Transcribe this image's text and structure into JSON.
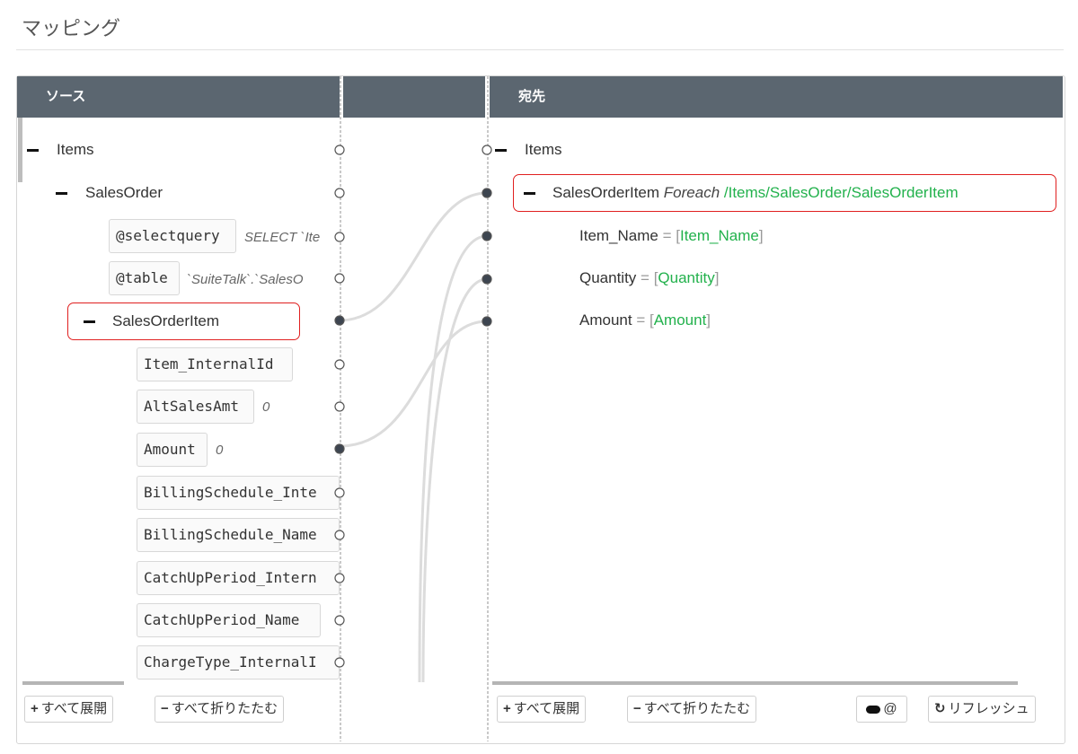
{
  "page": {
    "title": "マッピング"
  },
  "source": {
    "header": "ソース",
    "nodes": {
      "items": "Items",
      "sales_order": "SalesOrder",
      "select_query": {
        "name": "@selectquery",
        "value": "SELECT `Ite"
      },
      "table": {
        "name": "@table",
        "value": "`SuiteTalk`.`SalesO"
      },
      "sales_order_item": "SalesOrderItem",
      "fields": [
        {
          "name": "Item_InternalId",
          "value": ""
        },
        {
          "name": "AltSalesAmt",
          "value": "0"
        },
        {
          "name": "Amount",
          "value": "0"
        },
        {
          "name": "BillingSchedule_Inte",
          "value": ""
        },
        {
          "name": "BillingSchedule_Name",
          "value": ""
        },
        {
          "name": "CatchUpPeriod_Intern",
          "value": ""
        },
        {
          "name": "CatchUpPeriod_Name",
          "value": ""
        },
        {
          "name": "ChargeType_InternalI",
          "value": ""
        }
      ]
    },
    "buttons": {
      "expand_all": "すべて展開",
      "collapse_all": "すべて折りたたむ"
    }
  },
  "destination": {
    "header": "宛先",
    "nodes": {
      "items": "Items",
      "sales_order_item": {
        "name": "SalesOrderItem",
        "foreach_label": "Foreach",
        "path": "/Items/SalesOrder/SalesOrderItem"
      },
      "mappings": [
        {
          "field": "Item_Name",
          "value": "Item_Name"
        },
        {
          "field": "Quantity",
          "value": "Quantity"
        },
        {
          "field": "Amount",
          "value": "Amount"
        }
      ]
    },
    "buttons": {
      "expand_all": "すべて展開",
      "collapse_all": "すべて折りたたむ",
      "toggle": "@",
      "refresh": "リフレッシュ"
    }
  },
  "colors": {
    "header_bg": "#5b6670",
    "highlight": "#e02020",
    "mapped_value": "#22b14c"
  },
  "icons": [
    "plus-icon",
    "minus-icon",
    "toggle-icon",
    "refresh-icon"
  ]
}
